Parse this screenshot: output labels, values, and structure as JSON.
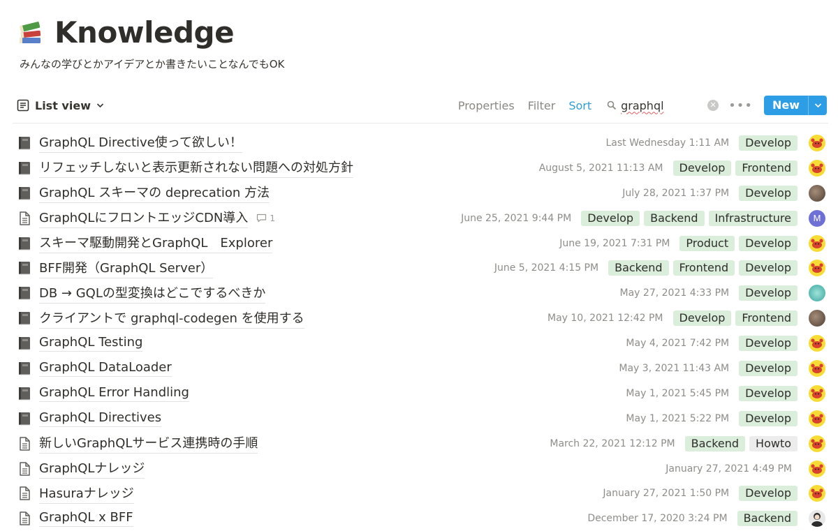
{
  "page": {
    "title": "Knowledge",
    "description": "みんなの学びとかアイデアとか書きたいことなんでもOK"
  },
  "toolbar": {
    "view_label": "List view",
    "properties_label": "Properties",
    "filter_label": "Filter",
    "sort_label": "Sort",
    "search_value": "graphql",
    "new_label": "New"
  },
  "colors": {
    "accent": "#2d9de5",
    "tag_green": "#dbeddb",
    "tag_gray": "#ebeceb"
  },
  "rows": [
    {
      "title": "GraphQL Directive使って欲しい！",
      "icon": "book-icon",
      "date": "Last Wednesday 1:11 AM",
      "tags": [
        "Develop"
      ],
      "avatar": "crab"
    },
    {
      "title": "リフェッチしないと表示更新されない問題への対処方針",
      "icon": "book-icon",
      "date": "August 5, 2021 11:13 AM",
      "tags": [
        "Develop",
        "Frontend"
      ],
      "avatar": "crab"
    },
    {
      "title": "GraphQL スキーマの deprecation 方法",
      "icon": "book-icon",
      "date": "July 28, 2021 1:37 PM",
      "tags": [
        "Develop"
      ],
      "avatar": "photo"
    },
    {
      "title": "GraphQLにフロントエッジCDN導入",
      "icon": "document-icon",
      "comments": "1",
      "date": "June 25, 2021 9:44 PM",
      "tags": [
        "Develop",
        "Backend",
        "Infrastructure"
      ],
      "avatar": "letter",
      "avatar_letter": "M"
    },
    {
      "title": "スキーマ駆動開発とGraphQL　Explorer",
      "icon": "book-icon",
      "date": "June 19, 2021 7:31 PM",
      "tags": [
        "Product",
        "Develop"
      ],
      "avatar": "crab"
    },
    {
      "title": "BFF開発（GraphQL Server）",
      "icon": "book-icon",
      "date": "June 5, 2021 4:15 PM",
      "tags": [
        "Backend",
        "Frontend",
        "Develop"
      ],
      "avatar": "crab"
    },
    {
      "title": "DB → GQLの型変換はどこでするべきか",
      "icon": "book-icon",
      "date": "May 27, 2021 4:33 PM",
      "tags": [
        "Develop"
      ],
      "avatar": "globe"
    },
    {
      "title": "クライアントで graphql-codegen を使用する",
      "icon": "book-icon",
      "date": "May 10, 2021 12:42 PM",
      "tags": [
        "Develop",
        "Frontend"
      ],
      "avatar": "photo"
    },
    {
      "title": "GraphQL Testing",
      "icon": "book-icon",
      "date": "May 4, 2021 7:42 PM",
      "tags": [
        "Develop"
      ],
      "avatar": "crab"
    },
    {
      "title": "GraphQL DataLoader",
      "icon": "book-icon",
      "date": "May 3, 2021 11:43 AM",
      "tags": [
        "Develop"
      ],
      "avatar": "crab"
    },
    {
      "title": "GraphQL Error Handling",
      "icon": "book-icon",
      "date": "May 1, 2021 5:45 PM",
      "tags": [
        "Develop"
      ],
      "avatar": "crab"
    },
    {
      "title": "GraphQL Directives",
      "icon": "book-icon",
      "date": "May 1, 2021 5:22 PM",
      "tags": [
        "Develop"
      ],
      "avatar": "crab"
    },
    {
      "title": "新しいGraphQLサービス連携時の手順",
      "icon": "document-icon",
      "date": "March 22, 2021 12:12 PM",
      "tags": [
        "Backend",
        "Howto"
      ],
      "avatar": "crab"
    },
    {
      "title": "GraphQLナレッジ",
      "icon": "document-icon",
      "date": "January 27, 2021 4:49 PM",
      "tags": [],
      "avatar": "crab"
    },
    {
      "title": "Hasuraナレッジ",
      "icon": "document-icon",
      "date": "January 27, 2021 1:50 PM",
      "tags": [
        "Develop"
      ],
      "avatar": "crab"
    },
    {
      "title": "GraphQL x BFF",
      "icon": "document-icon",
      "date": "December 17, 2020 3:24 PM",
      "tags": [
        "Backend"
      ],
      "avatar": "person"
    }
  ]
}
